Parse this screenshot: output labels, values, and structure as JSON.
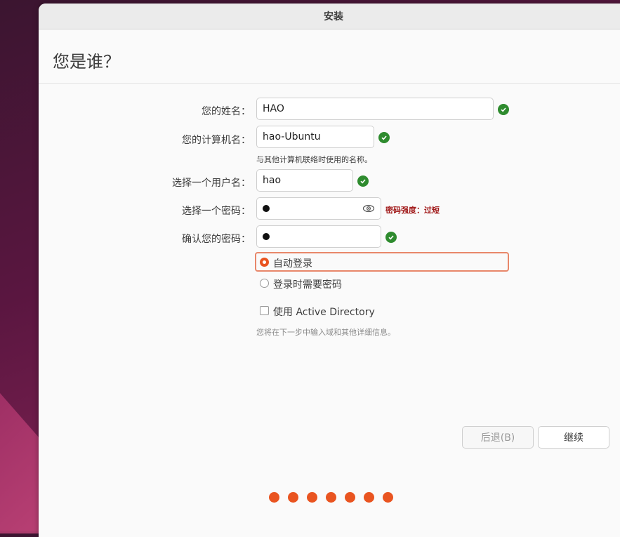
{
  "window": {
    "title": "安装"
  },
  "page": {
    "title": "您是谁？"
  },
  "form": {
    "name": {
      "label": "您的姓名：",
      "value": "HAO"
    },
    "computer": {
      "label": "您的计算机名：",
      "value": "hao-Ubuntu",
      "hint": "与其他计算机联络时使用的名称。"
    },
    "username": {
      "label": "选择一个用户名：",
      "value": "hao"
    },
    "password": {
      "label": "选择一个密码：",
      "strength": "密码强度：过短"
    },
    "confirm": {
      "label": "确认您的密码："
    }
  },
  "login_options": {
    "auto_login": {
      "label": "自动登录",
      "selected": true
    },
    "require_password": {
      "label": "登录时需要密码",
      "selected": false
    }
  },
  "active_directory": {
    "label": "使用 Active Directory",
    "checked": false,
    "note": "您将在下一步中输入域和其他详细信息。"
  },
  "buttons": {
    "back": "后退(B)",
    "continue": "继续"
  },
  "progress": {
    "total_steps": 7
  },
  "colors": {
    "accent": "#e95420",
    "ok": "#2e8b2e",
    "weak": "#a11a1a"
  }
}
